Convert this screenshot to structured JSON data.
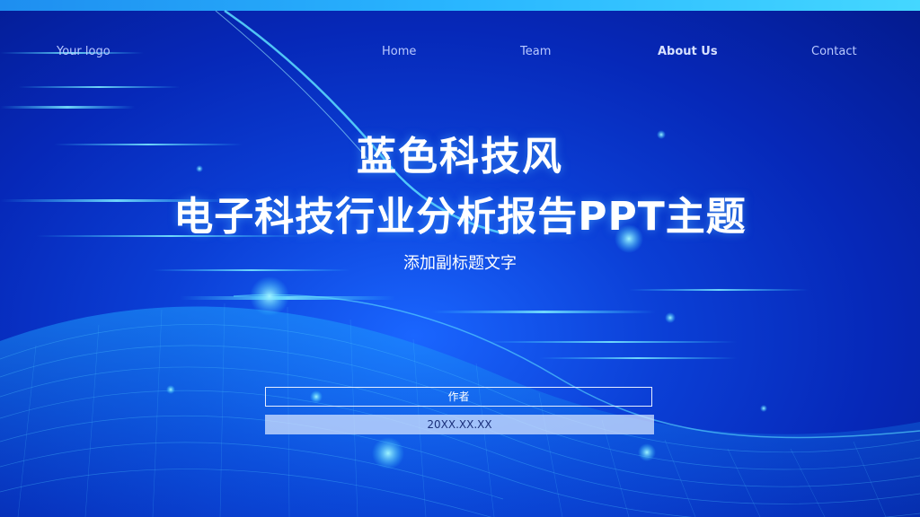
{
  "nav": {
    "logo": "Your logo",
    "items": [
      "Home",
      "Team",
      "About Us",
      "Contact"
    ]
  },
  "title": {
    "line1": "蓝色科技风",
    "line2": "电子科技行业分析报告PPT主题"
  },
  "subtitle": "添加副标题文字",
  "author_label": "作者",
  "date_label": "20XX.XX.XX",
  "colors": {
    "background": "#0628b8",
    "accent": "#29b6ff",
    "text": "#ffffff"
  }
}
